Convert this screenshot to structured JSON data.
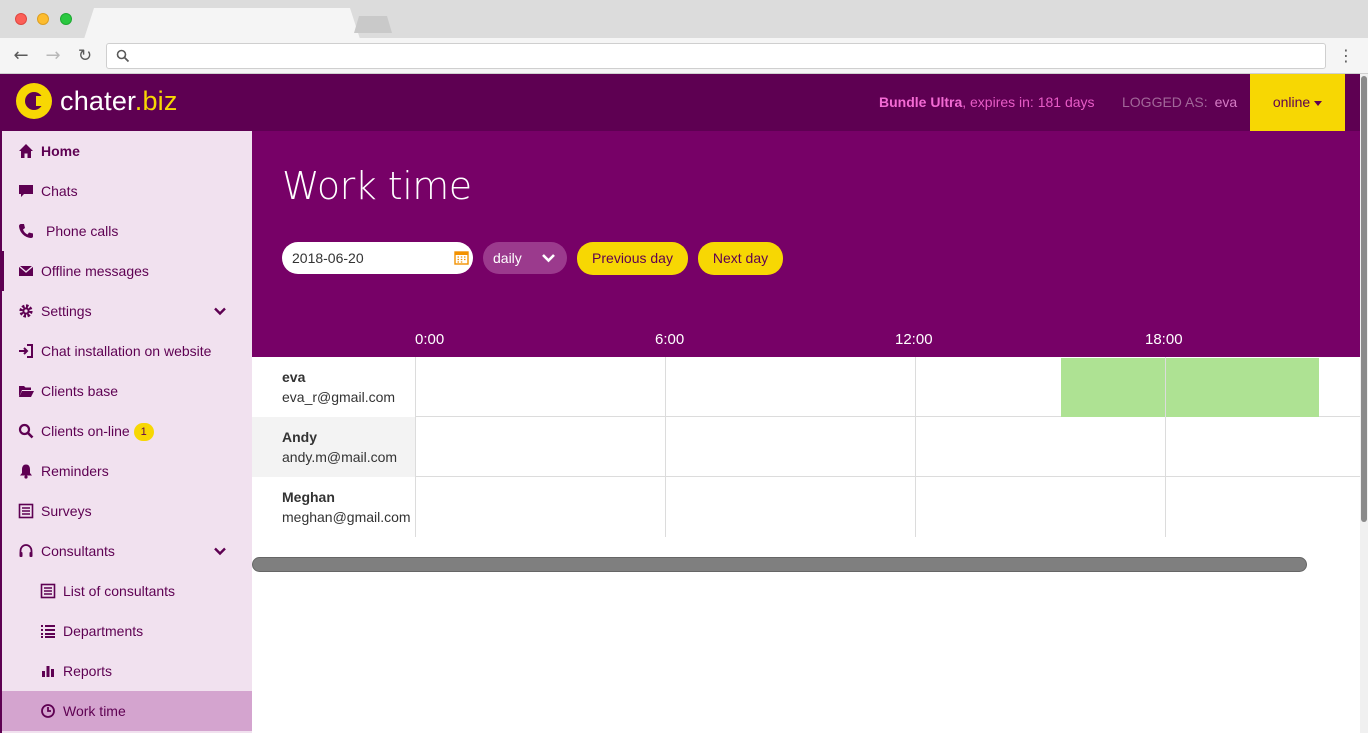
{
  "browser": {
    "url": ""
  },
  "header": {
    "logo_text_main": "chater",
    "logo_text_tld": ".biz",
    "bundle_name": "Bundle Ultra",
    "bundle_expiry": ", expires in: 181 days",
    "logged_as_label": "LOGGED AS:",
    "logged_user": "eva",
    "status_label": "online",
    "colors": {
      "brand_purple": "#5e0052",
      "brand_yellow": "#f7d703",
      "worked_green": "#aee293"
    }
  },
  "sidebar": {
    "items": [
      {
        "label": "Home",
        "icon": "home-icon"
      },
      {
        "label": "Chats",
        "icon": "chat-bubble-icon"
      },
      {
        "label": "Phone calls",
        "icon": "phone-icon"
      },
      {
        "label": "Offline messages",
        "icon": "envelope-icon"
      },
      {
        "label": "Settings",
        "icon": "gear-icon"
      },
      {
        "label": "Chat installation on website",
        "icon": "sign-in-icon"
      },
      {
        "label": "Clients base",
        "icon": "folder-open-icon"
      },
      {
        "label": "Clients on-line",
        "icon": "search-icon",
        "badge": "1"
      },
      {
        "label": "Reminders",
        "icon": "bell-icon"
      },
      {
        "label": "Surveys",
        "icon": "list-alt-icon"
      },
      {
        "label": "Consultants",
        "icon": "headset-icon"
      },
      {
        "label": "List of consultants",
        "icon": "list-alt-icon"
      },
      {
        "label": "Departments",
        "icon": "list-icon"
      },
      {
        "label": "Reports",
        "icon": "bar-chart-icon"
      },
      {
        "label": "Work time",
        "icon": "clock-icon"
      }
    ]
  },
  "main": {
    "title": "Work time",
    "date_value": "2018-06-20",
    "period_value": "daily",
    "prev_label": "Previous day",
    "next_label": "Next day",
    "hours": [
      "0:00",
      "6:00",
      "12:00",
      "18:00"
    ],
    "consultants": [
      {
        "name": "eva",
        "email": "eva_r@gmail.com",
        "worked_from_hour": 15.5,
        "worked_to_hour": 21.7
      },
      {
        "name": "Andy",
        "email": "andy.m@mail.com"
      },
      {
        "name": "Meghan",
        "email": "meghan@gmail.com"
      }
    ]
  }
}
